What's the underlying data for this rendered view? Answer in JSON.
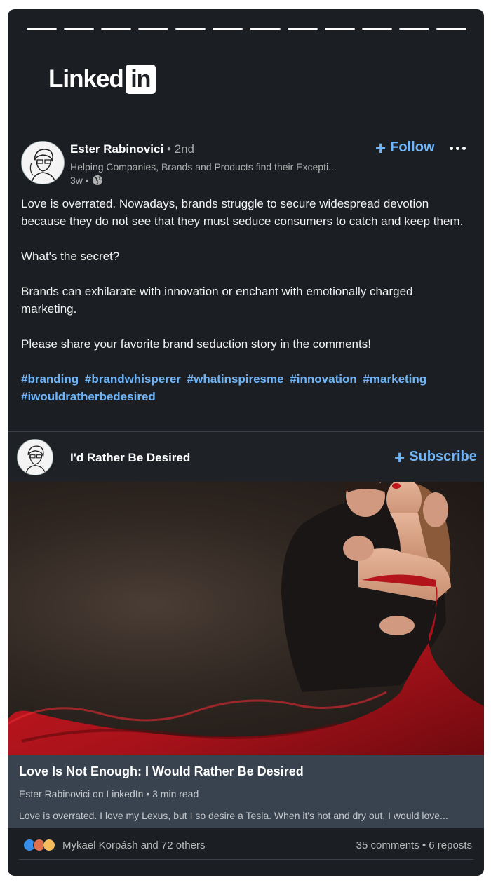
{
  "brand": {
    "logo_text": "Linked",
    "logo_in": "in"
  },
  "post": {
    "author_name": "Ester Rabinovici",
    "degree": " • 2nd",
    "headline": "Helping Companies, Brands and Products find their Excepti...",
    "time": "3w •",
    "follow_label": "Follow",
    "paragraphs": [
      "Love is overrated. Nowadays, brands struggle to secure widespread devotion because they do not see that they must seduce consumers to catch and keep them.",
      "What's the secret?",
      "Brands can exhilarate with innovation or enchant with emotionally charged marketing.",
      "Please share your favorite brand seduction story in the comments!"
    ],
    "hashtags": [
      "#branding",
      "#brandwhisperer",
      "#whatinspiresme",
      "#innovation",
      "#marketing",
      "#iwouldratherbedesired"
    ]
  },
  "newsletter": {
    "name": "I'd Rather Be Desired",
    "subscribe_label": "Subscribe"
  },
  "article": {
    "title": "Love Is Not Enough: I Would Rather Be Desired",
    "meta": "Ester Rabinovici on LinkedIn • 3 min read",
    "snippet": "Love is overrated. I love my Lexus, but I so desire a Tesla. When it's hot and dry out, I would love..."
  },
  "social": {
    "reactors": "Mykael Korpásh and 72 others",
    "counts": "35 comments • 6 reposts"
  },
  "colors": {
    "background": "#1b1f23",
    "accent": "#70b5f9",
    "dress": "#b3141c"
  }
}
